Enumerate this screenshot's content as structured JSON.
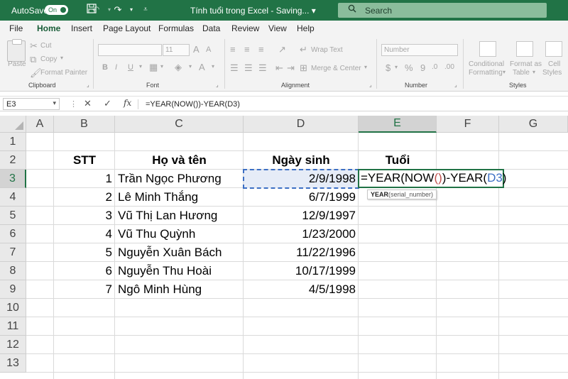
{
  "titlebar": {
    "autosave_label": "AutoSave",
    "autosave_state": "On",
    "title": "Tính tuổi trong Excel - Saving...",
    "title_dropdown": "▾",
    "search_placeholder": "Search",
    "accent": "#217346"
  },
  "tabs": [
    "File",
    "Home",
    "Insert",
    "Page Layout",
    "Formulas",
    "Data",
    "Review",
    "View",
    "Help"
  ],
  "active_tab": "Home",
  "ribbon": {
    "clipboard": {
      "label": "Clipboard",
      "paste": "Paste",
      "cut": "Cut",
      "copy": "Copy",
      "format_painter": "Format Painter"
    },
    "font": {
      "label": "Font",
      "size": "11",
      "bold": "B",
      "italic": "I",
      "underline": "U"
    },
    "alignment": {
      "label": "Alignment",
      "wrap_text": "Wrap Text",
      "merge_center": "Merge & Center"
    },
    "number": {
      "label": "Number",
      "format": "Number",
      "currency": "$",
      "percent": "%",
      "comma": "9"
    },
    "styles": {
      "label": "Styles",
      "conditional_1": "Conditional",
      "conditional_2": "Formatting",
      "format_as_1": "Format as",
      "format_as_2": "Table",
      "cell_1": "Cell",
      "cell_2": "Styles"
    }
  },
  "formula_bar": {
    "name_box": "E3",
    "cancel": "✕",
    "enter": "✓",
    "fx": "fx",
    "formula": "=YEAR(NOW())-YEAR(D3)"
  },
  "columns": [
    "A",
    "B",
    "C",
    "D",
    "E",
    "F",
    "G"
  ],
  "rows": [
    "1",
    "2",
    "3",
    "4",
    "5",
    "6",
    "7",
    "8",
    "9",
    "10",
    "11",
    "12",
    "13"
  ],
  "active_cell": {
    "column": "E",
    "row": "3"
  },
  "table": {
    "headers": {
      "stt": "STT",
      "name": "Họ và tên",
      "dob": "Ngày sinh",
      "age": "Tuổi"
    },
    "records": [
      {
        "stt": "1",
        "name": "Trần Ngọc Phương",
        "dob": "2/9/1998"
      },
      {
        "stt": "2",
        "name": "Lê Minh Thắng",
        "dob": "6/7/1999"
      },
      {
        "stt": "3",
        "name": "Vũ Thị Lan Hương",
        "dob": "12/9/1997"
      },
      {
        "stt": "4",
        "name": "Vũ Thu Quỳnh",
        "dob": "1/23/2000"
      },
      {
        "stt": "5",
        "name": "Nguyễn Xuân Bách",
        "dob": "11/22/1996"
      },
      {
        "stt": "6",
        "name": "Nguyễn Thu Hoài",
        "dob": "10/17/1999"
      },
      {
        "stt": "7",
        "name": "Ngô Minh Hùng",
        "dob": "4/5/1998"
      }
    ]
  },
  "editing": {
    "part1": "=YEAR(NOW",
    "open_paren": "(",
    "close_paren": ")",
    "part2": ")-YEAR(",
    "ref": "D3",
    "end": ")"
  },
  "tooltip": {
    "fn": "YEAR",
    "args": "(serial_number)"
  }
}
